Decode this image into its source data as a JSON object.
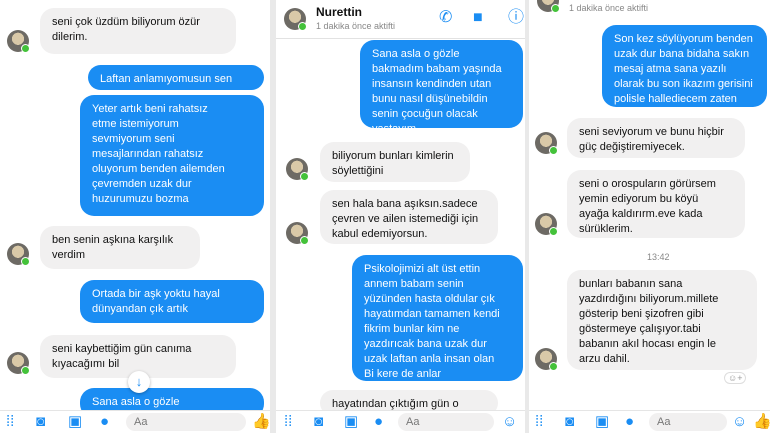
{
  "panel1": {
    "messages": [
      {
        "dir": "in",
        "text": "seni çok üzdüm biliyorum özür\ndilerim."
      },
      {
        "dir": "out",
        "text": "Laftan anlamıyomusun sen"
      },
      {
        "dir": "out",
        "text": "Yeter artık beni rahatsız\netme istemiyorum\nsevmiyorum seni\nmesajlarından rahatsız\noluyorum benden ailemden\nçevremden uzak dur\nhuzurumuzu bozma"
      },
      {
        "dir": "in",
        "text": "ben senin aşkına karşılık\nverdim"
      },
      {
        "dir": "out",
        "text": "Ortada bir aşk yoktu hayal\ndünyandan çık artık"
      },
      {
        "dir": "in",
        "text": "seni kaybettiğim gün canıma\nkıyacağımı bil"
      },
      {
        "dir": "out",
        "text": "Sana asla o gözle"
      }
    ],
    "input_placeholder": "Aa"
  },
  "panel2": {
    "contact_name": "Nurettin",
    "status": "1 dakika önce aktifti",
    "messages": [
      {
        "dir": "out",
        "text": "Sana asla o gözle\nbakmadım babam yaşında\ninsansın kendinden utan\nbunu nasıl düşünebildin\nsenin çocuğun olacak\nyaştayım"
      },
      {
        "dir": "in",
        "text": "biliyorum bunları kimlerin\nsöylettiğini"
      },
      {
        "dir": "in",
        "text": "sen hala bana aşıksın.sadece\nçevren ve ailen istemediği için\nkabul edemiyorsun."
      },
      {
        "dir": "out",
        "text": "Psikolojimizi alt üst ettin\nannem babam senin\nyüzünden hasta oldular çık\nhayatımdan tamamen kendi\nfikrim bunlar kim ne\nyazdırıcak bana uzak dur\nuzak laftan anla insan olan\nBi kere de anlar"
      },
      {
        "dir": "in",
        "text": "hayatından çıktığım gün o"
      }
    ],
    "input_placeholder": "Aa"
  },
  "panel3": {
    "status": "1 dakika önce aktifti",
    "timestamp": "13:42",
    "messages": [
      {
        "dir": "out",
        "text": "Son kez söylüyorum benden\nuzak dur bana bidaha sakın\nmesaj atma sana yazılı\nolarak bu son ikazım gerisini\npolisle hallediecem zaten"
      },
      {
        "dir": "in",
        "text": "seni seviyorum ve bunu hiçbir\ngüç değiştiremiyecek."
      },
      {
        "dir": "in",
        "text": "seni o orospuların görürsem\nyemin ediyorum bu köyü\nayağa kaldırırm.eve kada\nsürüklerim."
      },
      {
        "dir": "in",
        "text": "bunları babanın sana\nyazdırdığını biliyorum.millete\ngösterip beni şizofren gibi\ngöstermeye çalışıyor.tabi\nbabanın akıl hocası engin le\narzu dahil."
      }
    ],
    "input_placeholder": "Aa"
  },
  "icons": {
    "bar": [
      "grid-icon",
      "camera-icon",
      "image-icon",
      "mic-icon",
      "emoji-icon",
      "like-icon"
    ],
    "header": [
      "phone-icon",
      "video-icon",
      "info-icon"
    ]
  },
  "colors": {
    "outgoing": "#1a8df3",
    "incoming": "#f1f0f0",
    "online": "#44c23a"
  }
}
